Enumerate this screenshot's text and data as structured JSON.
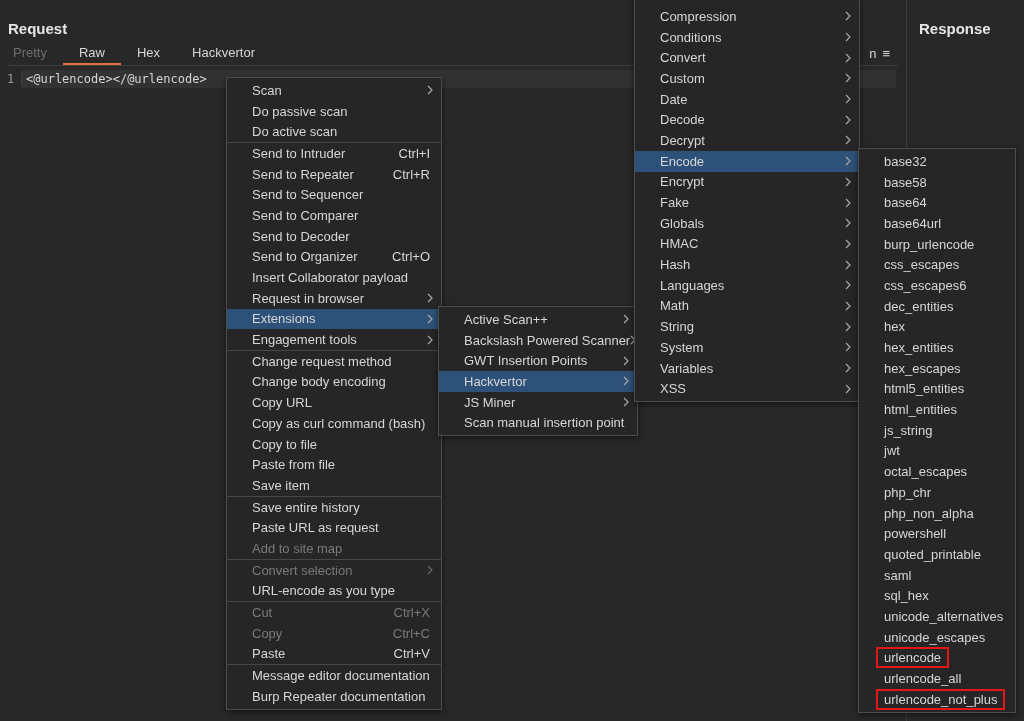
{
  "request": {
    "title": "Request",
    "tabs": [
      {
        "label": "Pretty",
        "selected": false,
        "disabled": true
      },
      {
        "label": "Raw",
        "selected": true,
        "disabled": false
      },
      {
        "label": "Hex",
        "selected": false,
        "disabled": false
      },
      {
        "label": "Hackvertor",
        "selected": false,
        "disabled": false
      }
    ],
    "tab_bar_partial_label": "n",
    "tab_bar_menu": "≡",
    "editor": {
      "lines": [
        {
          "number": "1",
          "text": "<@urlencode></@urlencode>"
        }
      ]
    }
  },
  "response": {
    "title": "Response"
  },
  "context_menu": {
    "groups": [
      [
        {
          "label": "Scan",
          "submenu": true,
          "disabled": false,
          "selected": false
        },
        {
          "label": "Do passive scan",
          "submenu": false,
          "disabled": false,
          "selected": false
        },
        {
          "label": "Do active scan",
          "submenu": false,
          "disabled": false,
          "selected": false
        }
      ],
      [
        {
          "label": "Send to Intruder",
          "shortcut": "Ctrl+I",
          "submenu": false,
          "disabled": false,
          "selected": false
        },
        {
          "label": "Send to Repeater",
          "shortcut": "Ctrl+R",
          "submenu": false,
          "disabled": false,
          "selected": false
        },
        {
          "label": "Send to Sequencer",
          "submenu": false,
          "disabled": false,
          "selected": false
        },
        {
          "label": "Send to Comparer",
          "submenu": false,
          "disabled": false,
          "selected": false
        },
        {
          "label": "Send to Decoder",
          "submenu": false,
          "disabled": false,
          "selected": false
        },
        {
          "label": "Send to Organizer",
          "shortcut": "Ctrl+O",
          "submenu": false,
          "disabled": false,
          "selected": false
        },
        {
          "label": "Insert Collaborator payload",
          "submenu": false,
          "disabled": false,
          "selected": false
        },
        {
          "label": "Request in browser",
          "submenu": true,
          "disabled": false,
          "selected": false
        },
        {
          "label": "Extensions",
          "submenu": true,
          "disabled": false,
          "selected": true
        },
        {
          "label": "Engagement tools",
          "submenu": true,
          "disabled": false,
          "selected": false
        }
      ],
      [
        {
          "label": "Change request method",
          "submenu": false,
          "disabled": false,
          "selected": false
        },
        {
          "label": "Change body encoding",
          "submenu": false,
          "disabled": false,
          "selected": false
        },
        {
          "label": "Copy URL",
          "submenu": false,
          "disabled": false,
          "selected": false
        },
        {
          "label": "Copy as curl command (bash)",
          "submenu": false,
          "disabled": false,
          "selected": false
        },
        {
          "label": "Copy to file",
          "submenu": false,
          "disabled": false,
          "selected": false
        },
        {
          "label": "Paste from file",
          "submenu": false,
          "disabled": false,
          "selected": false
        },
        {
          "label": "Save item",
          "submenu": false,
          "disabled": false,
          "selected": false
        }
      ],
      [
        {
          "label": "Save entire history",
          "submenu": false,
          "disabled": false,
          "selected": false
        },
        {
          "label": "Paste URL as request",
          "submenu": false,
          "disabled": false,
          "selected": false
        },
        {
          "label": "Add to site map",
          "submenu": false,
          "disabled": true,
          "selected": false
        }
      ],
      [
        {
          "label": "Convert selection",
          "submenu": true,
          "disabled": true,
          "selected": false
        },
        {
          "label": "URL-encode as you type",
          "submenu": false,
          "disabled": false,
          "selected": false
        }
      ],
      [
        {
          "label": "Cut",
          "shortcut": "Ctrl+X",
          "submenu": false,
          "disabled": true,
          "selected": false
        },
        {
          "label": "Copy",
          "shortcut": "Ctrl+C",
          "submenu": false,
          "disabled": true,
          "selected": false
        },
        {
          "label": "Paste",
          "shortcut": "Ctrl+V",
          "submenu": false,
          "disabled": false,
          "selected": false
        }
      ],
      [
        {
          "label": "Message editor documentation",
          "submenu": false,
          "disabled": false,
          "selected": false
        },
        {
          "label": "Burp Repeater documentation",
          "submenu": false,
          "disabled": false,
          "selected": false
        }
      ]
    ]
  },
  "extensions_menu": {
    "items": [
      {
        "label": "Active Scan++",
        "submenu": true,
        "selected": false
      },
      {
        "label": "Backslash Powered Scanner",
        "submenu": true,
        "selected": false
      },
      {
        "label": "GWT Insertion Points",
        "submenu": true,
        "selected": false
      },
      {
        "label": "Hackvertor",
        "submenu": true,
        "selected": true
      },
      {
        "label": "JS Miner",
        "submenu": true,
        "selected": false
      },
      {
        "label": "Scan manual insertion point",
        "submenu": false,
        "selected": false
      }
    ]
  },
  "hackvertor_menu": {
    "items": [
      {
        "label": "Compression",
        "selected": false
      },
      {
        "label": "Conditions",
        "selected": false
      },
      {
        "label": "Convert",
        "selected": false
      },
      {
        "label": "Custom",
        "selected": false
      },
      {
        "label": "Date",
        "selected": false
      },
      {
        "label": "Decode",
        "selected": false
      },
      {
        "label": "Decrypt",
        "selected": false
      },
      {
        "label": "Encode",
        "selected": true
      },
      {
        "label": "Encrypt",
        "selected": false
      },
      {
        "label": "Fake",
        "selected": false
      },
      {
        "label": "Globals",
        "selected": false
      },
      {
        "label": "HMAC",
        "selected": false
      },
      {
        "label": "Hash",
        "selected": false
      },
      {
        "label": "Languages",
        "selected": false
      },
      {
        "label": "Math",
        "selected": false
      },
      {
        "label": "String",
        "selected": false
      },
      {
        "label": "System",
        "selected": false
      },
      {
        "label": "Variables",
        "selected": false
      },
      {
        "label": "XSS",
        "selected": false
      }
    ]
  },
  "encode_menu": {
    "items": [
      {
        "label": "base32",
        "highlighted": false
      },
      {
        "label": "base58",
        "highlighted": false
      },
      {
        "label": "base64",
        "highlighted": false
      },
      {
        "label": "base64url",
        "highlighted": false
      },
      {
        "label": "burp_urlencode",
        "highlighted": false
      },
      {
        "label": "css_escapes",
        "highlighted": false
      },
      {
        "label": "css_escapes6",
        "highlighted": false
      },
      {
        "label": "dec_entities",
        "highlighted": false
      },
      {
        "label": "hex",
        "highlighted": false
      },
      {
        "label": "hex_entities",
        "highlighted": false
      },
      {
        "label": "hex_escapes",
        "highlighted": false
      },
      {
        "label": "html5_entities",
        "highlighted": false
      },
      {
        "label": "html_entities",
        "highlighted": false
      },
      {
        "label": "js_string",
        "highlighted": false
      },
      {
        "label": "jwt",
        "highlighted": false
      },
      {
        "label": "octal_escapes",
        "highlighted": false
      },
      {
        "label": "php_chr",
        "highlighted": false
      },
      {
        "label": "php_non_alpha",
        "highlighted": false
      },
      {
        "label": "powershell",
        "highlighted": false
      },
      {
        "label": "quoted_printable",
        "highlighted": false
      },
      {
        "label": "saml",
        "highlighted": false
      },
      {
        "label": "sql_hex",
        "highlighted": false
      },
      {
        "label": "unicode_alternatives",
        "highlighted": false
      },
      {
        "label": "unicode_escapes",
        "highlighted": false
      },
      {
        "label": "urlencode",
        "highlighted": true
      },
      {
        "label": "urlencode_all",
        "highlighted": false
      },
      {
        "label": "urlencode_not_plus",
        "highlighted": true
      }
    ]
  }
}
